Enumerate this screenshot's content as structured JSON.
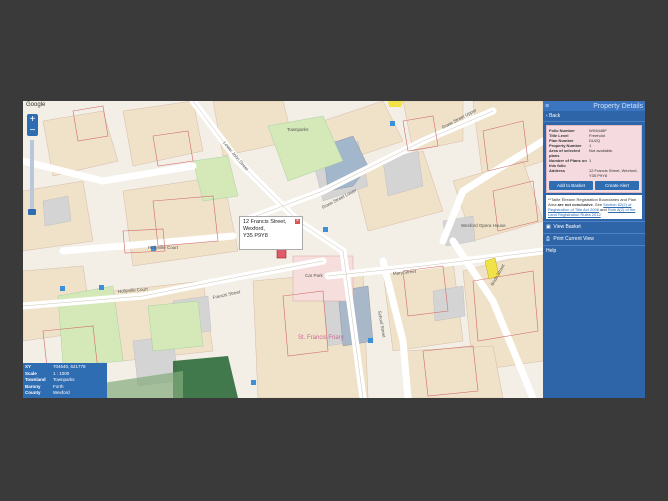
{
  "map": {
    "google_label": "Google",
    "zoom_in": "+",
    "zoom_out": "−",
    "street_labels": [
      "Lower John Street",
      "Rowe Street Lower",
      "Rowe Street Upper",
      "Francis Street",
      "Mary Street",
      "School Street",
      "Hollyville Court",
      "Hollyville Court",
      "St. Francis Friary",
      "Car Park",
      "Townparks",
      "Wexford Opera House",
      "Bride Street"
    ],
    "popup": {
      "line1": "12 Francis Street,",
      "line2": "Wexford,",
      "line3": "Y35 P9Y8",
      "close": "×"
    },
    "info_box": {
      "rows": [
        {
          "k": "XY",
          "v": "704640, 621778"
        },
        {
          "k": "Scale",
          "v": "1 : 1000"
        },
        {
          "k": "Townland",
          "v": "Townparks"
        },
        {
          "k": "Barony",
          "v": "Forth"
        },
        {
          "k": "County",
          "v": "Wexford"
        }
      ]
    }
  },
  "panel": {
    "menu_icon": "≡",
    "title": "Property Details",
    "back": "Back",
    "details": [
      {
        "k": "Folio Number",
        "v": "WX6448F"
      },
      {
        "k": "Title Level",
        "v": "Freehold"
      },
      {
        "k": "Plan Number",
        "v": "DU2Q"
      },
      {
        "k": "Property Number",
        "v": "1"
      },
      {
        "k": "Area of selected plans",
        "v": "Not available."
      },
      {
        "k": "Number of Plans on this folio",
        "v": "1"
      },
      {
        "k": "Address",
        "v": "12 Francis Street, Wexford, Y35 P9Y8"
      }
    ],
    "add_basket": "Add to Basket",
    "create_alert": "Create Alert",
    "note_start": "**Tailte Éireann Registration Boundaries and Plan Area",
    "note_bold": "are not conclusive",
    "note_mid": ". See",
    "note_link1": "Section 62(2) of Registration of Title Act 2006",
    "note_and": "and",
    "note_link2": "Rule 8(2) of the Land Registration Rules 2012",
    "view_basket": "View Basket",
    "print_view": "Print Current View",
    "help": "Help"
  },
  "colors": {
    "panel": "#2e64a8",
    "accent": "#2f6db3",
    "details_bg": "#f5dbe0"
  }
}
